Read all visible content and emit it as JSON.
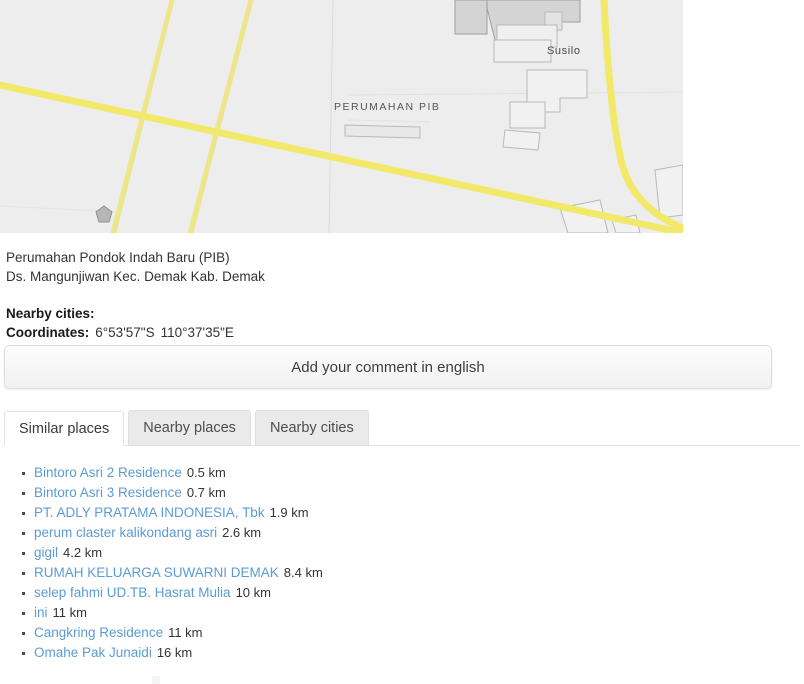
{
  "map": {
    "area_label": "PERUMAHAN PIB",
    "building_label": "Susilo",
    "road_color": "#f2e96b",
    "land_color": "#ededed",
    "building_fill": "#d4d4d4"
  },
  "place": {
    "name": "Perumahan Pondok Indah Baru (PIB)",
    "address": "Ds. Mangunjiwan Kec. Demak Kab. Demak",
    "nearby_cities_label": "Nearby cities:",
    "coordinates_label": "Coordinates:",
    "latitude": "6°53'57\"S",
    "longitude": "110°37'35\"E"
  },
  "comment": {
    "button_label": "Add your comment in english"
  },
  "tabs": [
    {
      "label": "Similar places",
      "active": true
    },
    {
      "label": "Nearby places",
      "active": false
    },
    {
      "label": "Nearby cities",
      "active": false
    }
  ],
  "similar_places": [
    {
      "name": "Bintoro Asri 2 Residence",
      "distance": "0.5 km"
    },
    {
      "name": "Bintoro Asri 3 Residence",
      "distance": "0.7 km"
    },
    {
      "name": "PT. ADLY PRATAMA INDONESIA, Tbk",
      "distance": "1.9 km"
    },
    {
      "name": "perum claster kalikondang asri",
      "distance": "2.6 km"
    },
    {
      "name": "gigil",
      "distance": "4.2 km"
    },
    {
      "name": "RUMAH KELUARGA SUWARNI DEMAK",
      "distance": "8.4 km"
    },
    {
      "name": "selep fahmi UD.TB. Hasrat Mulia",
      "distance": "10 km"
    },
    {
      "name": "ini",
      "distance": "11 km"
    },
    {
      "name": "Cangkring Residence",
      "distance": "11 km"
    },
    {
      "name": "Omahe Pak Junaidi",
      "distance": "16 km"
    }
  ],
  "colors": {
    "link": "#5b9bd5",
    "text": "#333333",
    "tab_active_bg": "#ffffff",
    "tab_inactive_bg": "#eaeaea"
  }
}
